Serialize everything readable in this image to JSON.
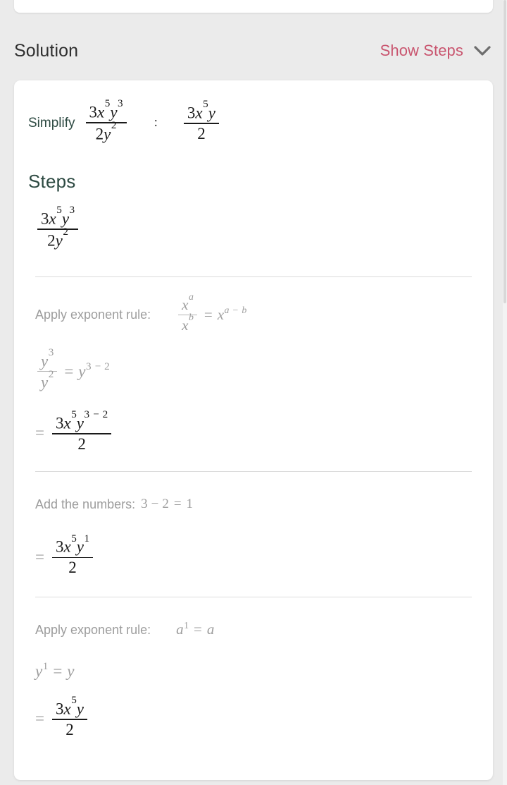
{
  "header": {
    "title": "Solution",
    "show_steps_label": "Show Steps",
    "show_steps_icon": "chevron-down-icon",
    "accent_color": "#c9556f",
    "title_color": "#2f2f2f"
  },
  "problem": {
    "simplify_label": "Simplify",
    "separator": ":",
    "expression": {
      "numerator": "3x^5 y^3",
      "denominator": "2y^2"
    },
    "answer": {
      "numerator": "3x^5 y",
      "denominator": "2"
    }
  },
  "steps_section": {
    "heading": "Steps",
    "heading_color": "#2d4a42"
  },
  "steps": [
    {
      "id": "step-initial-expression",
      "kind": "expression",
      "math": "3x^5 y^3 / 2y^2",
      "parts": {
        "num_coef": "3",
        "num_x": "x",
        "num_x_sup": "5",
        "num_y": "y",
        "num_y_sup": "3",
        "den_coef": "2",
        "den_y": "y",
        "den_y_sup": "2"
      }
    },
    {
      "id": "step-exponent-rule-quotient",
      "kind": "rule",
      "description": "Apply exponent rule:",
      "rule_math": "x^a / x^b = x^(a-b)",
      "rule_parts": {
        "x1": "x",
        "x1_sup": "a",
        "x2": "x",
        "x2_sup": "b",
        "eq": "=",
        "x3": "x",
        "x3_sup_a": "a",
        "x3_sup_minus": "−",
        "x3_sup_b": "b"
      },
      "work": {
        "y_num": "y",
        "y_num_sup": "3",
        "y_den": "y",
        "y_den_sup": "2",
        "eq": "=",
        "result": "y",
        "result_sup_a": "3",
        "result_sup_minus": "−",
        "result_sup_b": "2"
      },
      "result": {
        "lead": "=",
        "num_coef": "3",
        "num_x": "x",
        "num_x_sup": "5",
        "num_y": "y",
        "num_y_sup_a": "3",
        "num_y_sup_minus": "−",
        "num_y_sup_b": "2",
        "den": "2"
      }
    },
    {
      "id": "step-add-the-numbers",
      "kind": "compute",
      "description": "Add the numbers:",
      "computation": "3 − 2 = 1",
      "computation_parts": {
        "a": "3",
        "minus": "−",
        "b": "2",
        "eq": "=",
        "result": "1"
      },
      "result": {
        "lead": "=",
        "num_coef": "3",
        "num_x": "x",
        "num_x_sup": "5",
        "num_y": "y",
        "num_y_sup": "1",
        "den": "2"
      }
    },
    {
      "id": "step-exponent-rule-identity",
      "kind": "rule",
      "description": "Apply exponent rule:",
      "rule_math": "a^1 = a",
      "rule_parts": {
        "a1": "a",
        "a1_sup": "1",
        "eq": "=",
        "a2": "a"
      },
      "work": {
        "y": "y",
        "y_sup": "1",
        "eq": "=",
        "result": "y"
      },
      "result": {
        "lead": "=",
        "num_coef": "3",
        "num_x": "x",
        "num_x_sup": "5",
        "num_y": "y",
        "den": "2"
      }
    }
  ],
  "scrollbar": {
    "orientation": "vertical",
    "position": "right"
  }
}
